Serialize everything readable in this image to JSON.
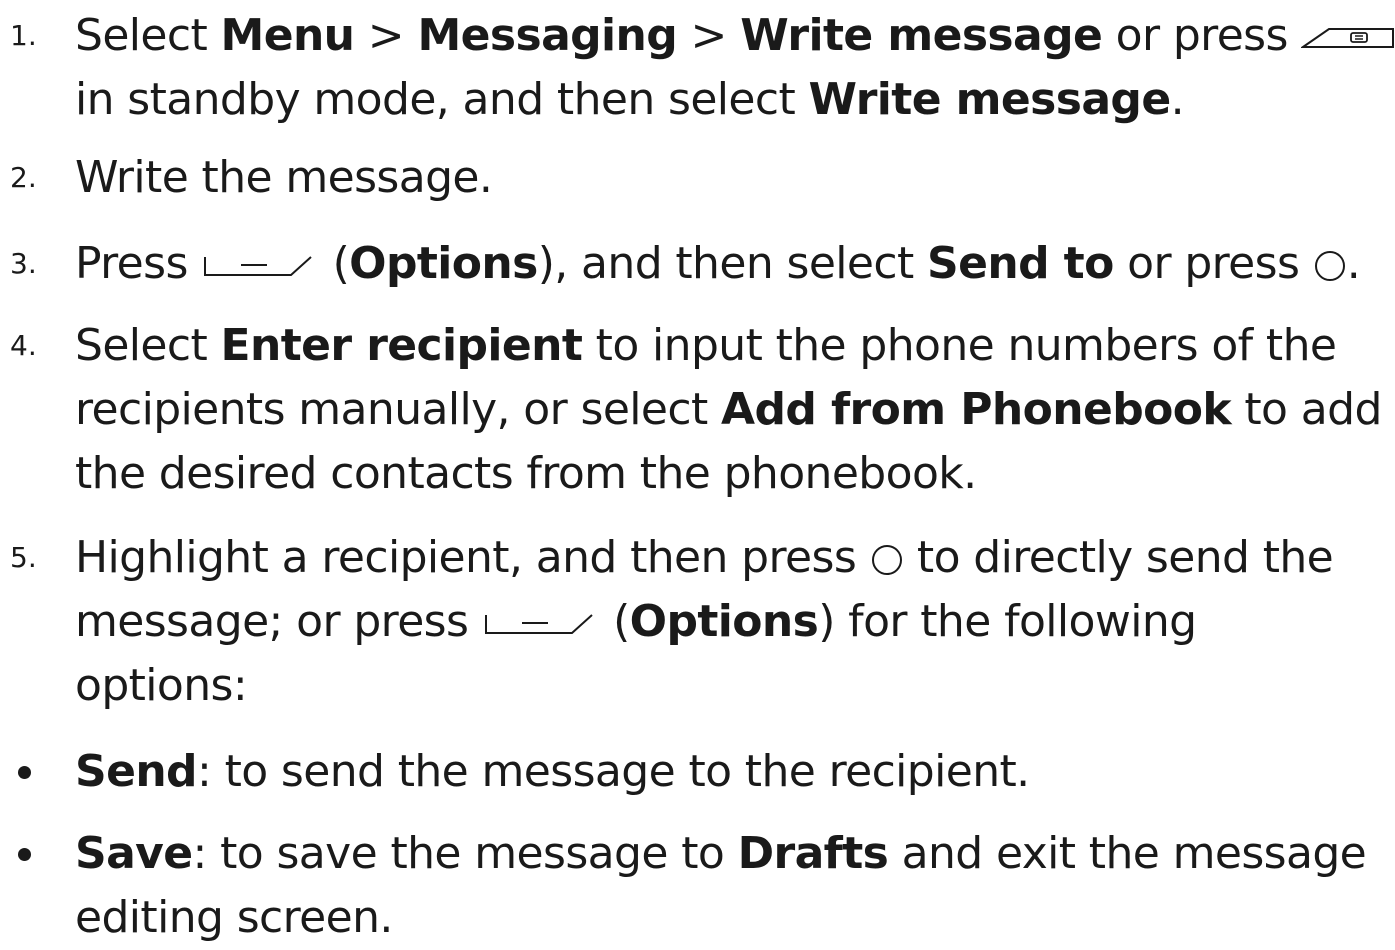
{
  "steps": [
    {
      "number": "1.",
      "lines": [
        [
          "Select ",
          "Menu",
          " > ",
          "Messaging",
          " > ",
          "Write message",
          " or press "
        ],
        [
          "in standby mode, and then select ",
          "Write message",
          "."
        ]
      ]
    },
    {
      "number": "2.",
      "text": "Write the message."
    },
    {
      "number": "3.",
      "parts": [
        "Press ",
        " (",
        "Options",
        "), and then select ",
        "Send to",
        " or press ",
        "."
      ]
    },
    {
      "number": "4.",
      "lines": [
        [
          "Select ",
          "Enter recipient",
          " to input the phone numbers of the"
        ],
        [
          "recipients manually, or select ",
          "Add from Phonebook",
          " to add"
        ],
        [
          "the desired contacts from the phonebook."
        ]
      ]
    },
    {
      "number": "5.",
      "lines": [
        [
          "Highlight a recipient, and then press ",
          " to directly send the"
        ],
        [
          "message; or press ",
          " (",
          "Options",
          ") for the following"
        ],
        [
          "options:"
        ]
      ]
    }
  ],
  "bullets": [
    {
      "term": "Send",
      "text": ": to send the message to the recipient."
    },
    {
      "term": "Save",
      "lines": [
        [
          ": to save the message to ",
          "Drafts",
          " and exit the message"
        ],
        [
          "editing screen."
        ]
      ]
    }
  ],
  "icons": {
    "message_key": "message-key-icon",
    "soft_key": "left-soft-key-icon",
    "confirm_key": "confirm-key-icon"
  }
}
